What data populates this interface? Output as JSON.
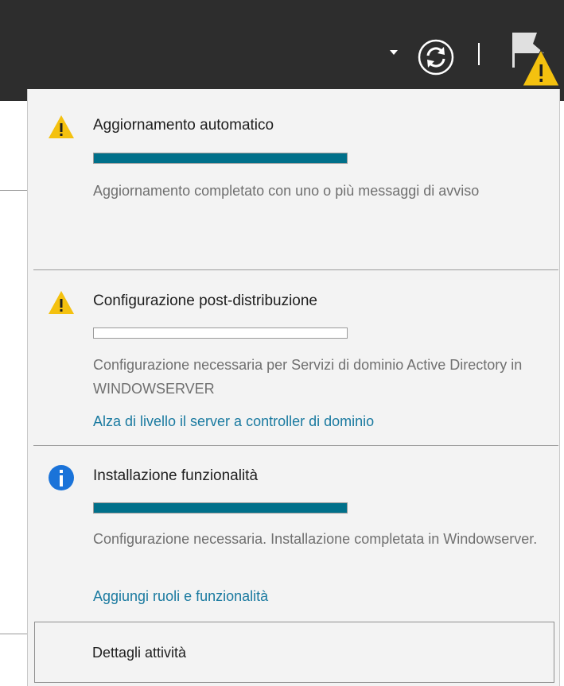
{
  "header": {
    "icons": [
      "chevron-down-icon",
      "refresh-icon",
      "notification-flag-icon",
      "warning-icon"
    ],
    "colors": {
      "background": "#2d2d2d",
      "foreground": "#ffffff",
      "warning": "#f4c10f"
    }
  },
  "notifications": [
    {
      "icon": "warning-icon",
      "title": "Aggiornamento automatico",
      "progress_percent": 100,
      "description": "Aggiornamento completato con uno o più messaggi di avviso",
      "link": ""
    },
    {
      "icon": "warning-icon",
      "title": "Configurazione post-distribuzione",
      "progress_percent": 0,
      "description": "Configurazione necessaria per Servizi di dominio Active Directory in WINDOWSERVER",
      "link": "Alza di livello il server a controller di dominio"
    },
    {
      "icon": "info-icon",
      "title": "Installazione funzionalità",
      "progress_percent": 100,
      "description": "Configurazione necessaria. Installazione completata in Windowserver.",
      "link": "Aggiungi ruoli e funzionalità"
    }
  ],
  "footer": {
    "details_label": "Dettagli attività"
  },
  "colors": {
    "progress": "#00708a",
    "link": "#1a7aa0",
    "info": "#1a73d9"
  }
}
